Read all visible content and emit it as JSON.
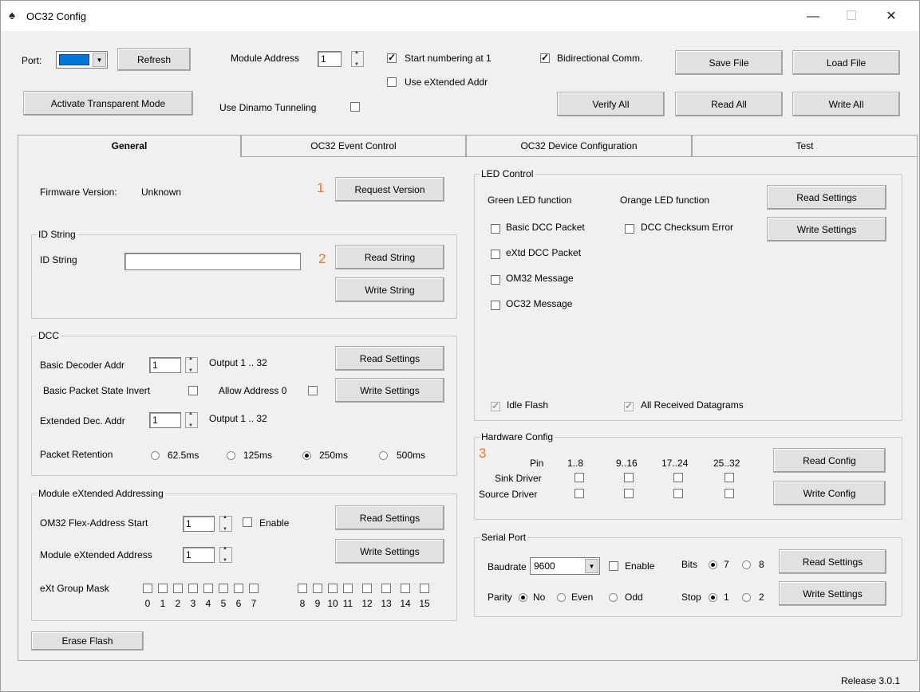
{
  "window": {
    "title": "OC32 Config",
    "controls": {
      "minimize": "—",
      "maximize": "☐",
      "close": "✕"
    }
  },
  "toolbar": {
    "port_label": "Port:",
    "refresh": "Refresh",
    "module_address_label": "Module Address",
    "module_address_value": "1",
    "start_numbering": {
      "label": "Start numbering at 1",
      "checked": true
    },
    "use_extended_addr": {
      "label": "Use eXtended Addr",
      "checked": false
    },
    "bidirectional": {
      "label": "Bidirectional Comm.",
      "checked": true
    },
    "save_file": "Save File",
    "load_file": "Load File",
    "activate_transparent": "Activate Transparent Mode",
    "dinamo_tunneling": {
      "label": "Use Dinamo Tunneling",
      "checked": false
    },
    "verify_all": "Verify All",
    "read_all": "Read All",
    "write_all": "Write All"
  },
  "tabs": [
    {
      "label": "General",
      "active": true
    },
    {
      "label": "OC32 Event Control",
      "active": false
    },
    {
      "label": "OC32 Device Configuration",
      "active": false
    },
    {
      "label": "Test",
      "active": false
    }
  ],
  "general": {
    "firmware_label": "Firmware Version:",
    "firmware_value": "Unknown",
    "marker1": "1",
    "request_version": "Request Version",
    "id_string_group": "ID String",
    "id_string_label": "ID String",
    "id_string_value": "",
    "marker2": "2",
    "read_string": "Read String",
    "write_string": "Write String",
    "dcc_group": "DCC",
    "basic_decoder_label": "Basic Decoder Addr",
    "basic_decoder_value": "1",
    "basic_output": "Output 1 .. 32",
    "dcc_read": "Read Settings",
    "packet_state_invert": "Basic Packet State Invert",
    "allow_address0": "Allow Address 0",
    "dcc_write": "Write Settings",
    "extended_dec_label": "Extended Dec. Addr",
    "extended_dec_value": "1",
    "extended_output": "Output 1 .. 32",
    "packet_retention_label": "Packet Retention",
    "retention_options": [
      {
        "label": "62.5ms",
        "selected": false
      },
      {
        "label": "125ms",
        "selected": false
      },
      {
        "label": "250ms",
        "selected": true
      },
      {
        "label": "500ms",
        "selected": false
      }
    ],
    "mxa_group": "Module eXtended Addressing",
    "om32_flex_label": "OM32 Flex-Address Start",
    "om32_flex_value": "1",
    "enable_label": "Enable",
    "mxa_read": "Read Settings",
    "module_ext_label": "Module eXtended Address",
    "module_ext_value": "1",
    "mxa_write": "Write Settings",
    "ext_group_mask_label": "eXt Group Mask",
    "mask_bits": [
      "0",
      "1",
      "2",
      "3",
      "4",
      "5",
      "6",
      "7",
      "8",
      "9",
      "10",
      "11",
      "12",
      "13",
      "14",
      "15"
    ],
    "erase_flash": "Erase Flash"
  },
  "led": {
    "group": "LED Control",
    "green_label": "Green LED function",
    "orange_label": "Orange LED function",
    "read": "Read Settings",
    "write": "Write Settings",
    "green_options": [
      "Basic DCC Packet",
      "eXtd DCC Packet",
      "OM32 Message",
      "OC32 Message"
    ],
    "orange_options": [
      "DCC Checksum Error"
    ],
    "idle_flash": "Idle Flash",
    "all_received": "All Received Datagrams"
  },
  "hardware": {
    "group": "Hardware Config",
    "marker3": "3",
    "pin_label": "Pin",
    "ranges": [
      "1..8",
      "9..16",
      "17..24",
      "25..32"
    ],
    "sink_label": "Sink Driver",
    "source_label": "Source Driver",
    "read": "Read Config",
    "write": "Write Config"
  },
  "serial": {
    "group": "Serial Port",
    "baudrate_label": "Baudrate",
    "baudrate_value": "9600",
    "enable_label": "Enable",
    "bits_label": "Bits",
    "bits_options": [
      "7",
      "8"
    ],
    "parity_label": "Parity",
    "parity_options": [
      "No",
      "Even",
      "Odd"
    ],
    "stop_label": "Stop",
    "stop_options": [
      "1",
      "2"
    ],
    "read": "Read Settings",
    "write": "Write Settings"
  },
  "status": {
    "release": "Release 3.0.1"
  },
  "colors": {
    "accent": "#f07a28",
    "port_swatch": "#0078d7"
  }
}
